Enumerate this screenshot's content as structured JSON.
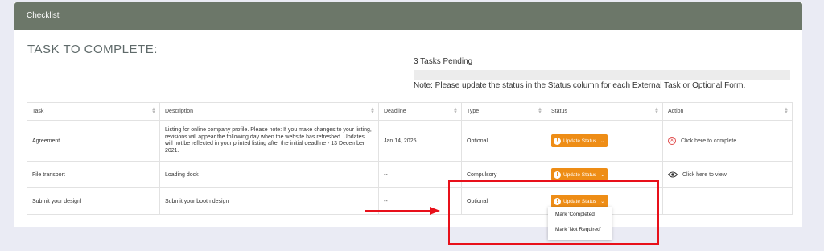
{
  "panel": {
    "title": "Checklist"
  },
  "page_title": "TASK TO COMPLETE:",
  "pending": "3 Tasks Pending",
  "note": "Note: Please update the status in the Status column for each External Task or Optional Form.",
  "table": {
    "headers": [
      "Task",
      "Description",
      "Deadline",
      "Type",
      "Status",
      "Action"
    ],
    "rows": [
      {
        "task": "Agreement",
        "description": "Listing for online company profile. Please note: If you make changes to your listing, revisions will appear the following day when the website has refreshed. Updates will not be reflected in your printed listing after the initial deadline - 13 December 2021.",
        "deadline": "Jan 14, 2025",
        "type": "Optional",
        "status": "Update Status",
        "action": "Click here to complete"
      },
      {
        "task": "File transport",
        "description": "Loading dock",
        "deadline": "--",
        "type": "Compulsory",
        "status": "Update Status",
        "action": "Click here to view"
      },
      {
        "task": "Submit your designl",
        "description": "Submit your booth design",
        "deadline": "--",
        "type": "Optional",
        "status": "Update Status",
        "action": ""
      }
    ]
  },
  "dropdown": {
    "options": [
      "Mark 'Completed'",
      "Mark 'Not Required'"
    ]
  },
  "colors": {
    "header_bg": "#6c7769",
    "status_button": "#ee8d16",
    "highlight": "#e8101a"
  },
  "icons": {
    "status": "exclamation-icon",
    "complete_action": "x-circle-icon",
    "view_action": "eye-icon",
    "sort": "sort-icon"
  }
}
